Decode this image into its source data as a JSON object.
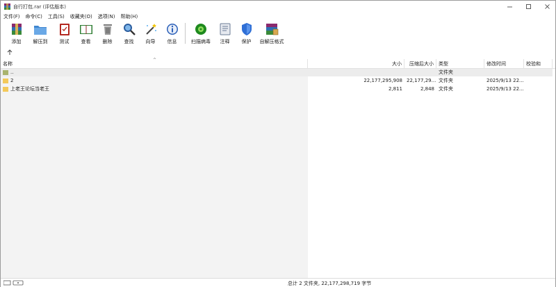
{
  "window": {
    "title": "自行打包.rar (评估版本)"
  },
  "menu": [
    "文件(F)",
    "命令(C)",
    "工具(S)",
    "收藏夹(O)",
    "选项(N)",
    "帮助(H)"
  ],
  "toolbar": [
    {
      "label": "添加",
      "icon": "add-archive-icon"
    },
    {
      "label": "解压到",
      "icon": "extract-folder-icon"
    },
    {
      "label": "测试",
      "icon": "test-clipboard-icon"
    },
    {
      "label": "查看",
      "icon": "view-book-icon"
    },
    {
      "label": "删除",
      "icon": "trash-icon"
    },
    {
      "label": "查找",
      "icon": "magnifier-icon"
    },
    {
      "label": "向导",
      "icon": "wizard-wand-icon"
    },
    {
      "label": "信息",
      "icon": "info-icon"
    },
    {
      "label": "扫描病毒",
      "icon": "virus-scan-icon"
    },
    {
      "label": "注释",
      "icon": "comment-icon"
    },
    {
      "label": "保护",
      "icon": "shield-icon"
    },
    {
      "label": "自解压格式",
      "icon": "sfx-boxes-icon"
    }
  ],
  "columns": {
    "name": "名称",
    "size": "大小",
    "packed": "压缩后大小",
    "type": "类型",
    "modified": "修改时间",
    "crc": "校验和"
  },
  "rows": [
    {
      "name": "..",
      "size": "",
      "packed": "",
      "type": "文件夹",
      "modified": "",
      "crc": ""
    },
    {
      "name": "2",
      "size": "22,177,295,908",
      "packed": "22,177,29...",
      "type": "文件夹",
      "modified": "2025/9/13 22...",
      "crc": ""
    },
    {
      "name": "上老王论坛当老王",
      "size": "2,811",
      "packed": "2,848",
      "type": "文件夹",
      "modified": "2025/9/13 22...",
      "crc": ""
    }
  ],
  "status": {
    "summary": "总计 2 文件夹, 22,177,298,719 字节"
  },
  "colors": {
    "folder": "#f3c95a",
    "folder_up": "#a9b36d"
  }
}
